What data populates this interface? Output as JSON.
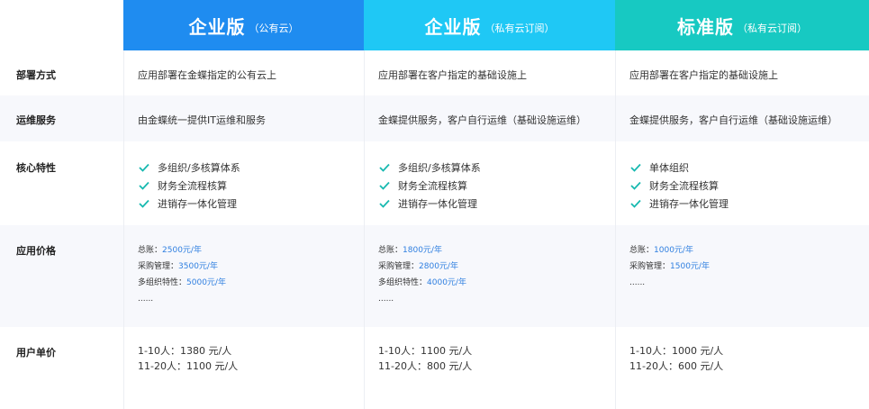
{
  "columns": [
    {
      "title": "企业版",
      "subtitle": "（公有云）",
      "color": "#1f8cf0"
    },
    {
      "title": "企业版",
      "subtitle": "（私有云订阅）",
      "color": "#1fc8f5"
    },
    {
      "title": "标准版",
      "subtitle": "（私有云订阅）",
      "color": "#17c9c2"
    }
  ],
  "rows": {
    "deploy": {
      "label": "部署方式",
      "values": [
        "应用部署在金蝶指定的公有云上",
        "应用部署在客户指定的基础设施上",
        "应用部署在客户指定的基础设施上"
      ]
    },
    "ops": {
      "label": "运维服务",
      "values": [
        "由金蝶统一提供IT运维和服务",
        "金蝶提供服务，客户自行运维（基础设施运维）",
        "金蝶提供服务，客户自行运维（基础设施运维）"
      ]
    },
    "core": {
      "label": "核心特性",
      "features": [
        [
          "多组织/多核算体系",
          "财务全流程核算",
          "进销存一体化管理"
        ],
        [
          "多组织/多核算体系",
          "财务全流程核算",
          "进销存一体化管理"
        ],
        [
          "单体组织",
          "财务全流程核算",
          "进销存一体化管理"
        ]
      ]
    },
    "price": {
      "label": "应用价格",
      "items": [
        [
          {
            "name": "总账：",
            "value": "2500元/年"
          },
          {
            "name": "采购管理：",
            "value": "3500元/年"
          },
          {
            "name": "多组织特性：",
            "value": "5000元/年"
          }
        ],
        [
          {
            "name": "总账：",
            "value": "1800元/年"
          },
          {
            "name": "采购管理：",
            "value": "2800元/年"
          },
          {
            "name": "多组织特性：",
            "value": "4000元/年"
          }
        ],
        [
          {
            "name": "总账：",
            "value": "1000元/年"
          },
          {
            "name": "采购管理：",
            "value": "1500元/年"
          }
        ]
      ],
      "ellipsis": "......"
    },
    "unit": {
      "label": "用户单价",
      "lines": [
        [
          "1-10人：1380 元/人",
          "11-20人：1100 元/人"
        ],
        [
          "1-10人：1100 元/人",
          "11-20人：800 元/人"
        ],
        [
          "1-10人：1000 元/人",
          "11-20人：600 元/人"
        ]
      ]
    }
  },
  "icons": {
    "check": "check-icon",
    "check_color": "#17b9b0"
  },
  "accent": {
    "price_value": "#2f7fe0"
  }
}
